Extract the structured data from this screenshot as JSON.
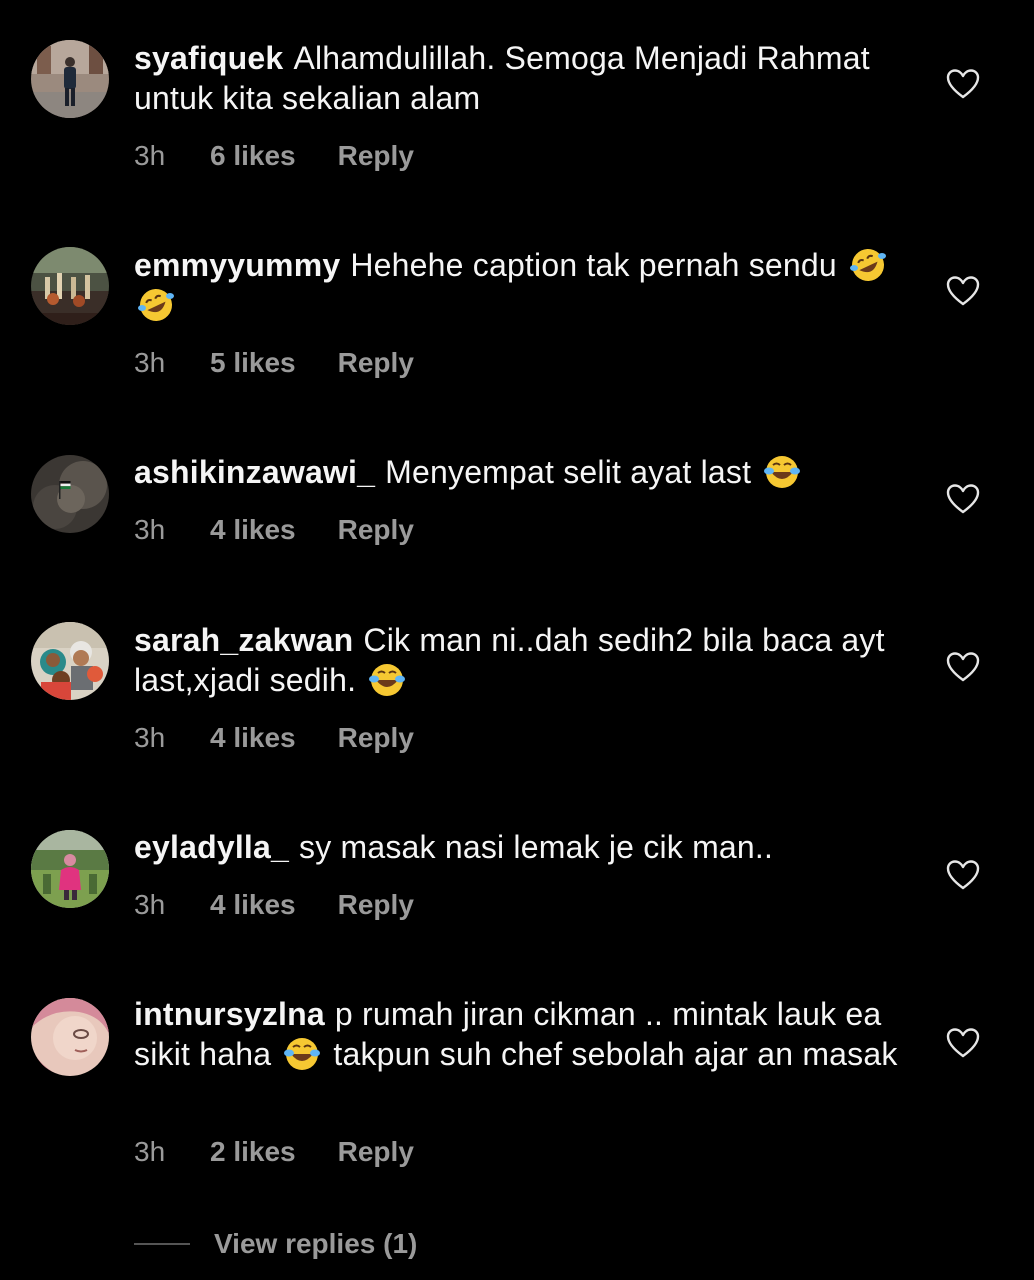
{
  "comments": [
    {
      "username": "syafiquek",
      "text": "Alhamdulillah. Semoga Menjadi Rahmat untuk kita sekalian alam",
      "time": "3h",
      "likes": "6 likes",
      "reply": "Reply"
    },
    {
      "username": "emmyyummy",
      "text": "Hehehe caption tak pernah sendu",
      "emoji": [
        "rofl-emoji",
        "rofl-emoji"
      ],
      "time": "3h",
      "likes": "5 likes",
      "reply": "Reply"
    },
    {
      "username": "ashikinzawawi_",
      "text": "Menyempat selit ayat last",
      "emoji": [
        "joy-emoji"
      ],
      "time": "3h",
      "likes": "4 likes",
      "reply": "Reply"
    },
    {
      "username": "sarah_zakwan",
      "text": "Cik man ni..dah sedih2 bila baca ayt last,xjadi sedih.",
      "emoji": [
        "joy-emoji"
      ],
      "time": "3h",
      "likes": "4 likes",
      "reply": "Reply"
    },
    {
      "username": "eyladylla_",
      "text": "sy masak nasi lemak je cik man..",
      "time": "3h",
      "likes": "4 likes",
      "reply": "Reply"
    },
    {
      "username": "intnursyzlna",
      "text_before": "p rumah jiran cikman .. mintak lauk ea sikit haha",
      "text_after": "takpun suh chef sebolah ajar an masak",
      "emoji": [
        "joy-emoji"
      ],
      "time": "3h",
      "likes": "2 likes",
      "reply": "Reply"
    }
  ],
  "view_replies": "View replies (1)",
  "icons": {
    "like": "heart-outline-icon"
  },
  "colors": {
    "background": "#000000",
    "text": "#f5f5f5",
    "meta": "#9a9a9a"
  }
}
